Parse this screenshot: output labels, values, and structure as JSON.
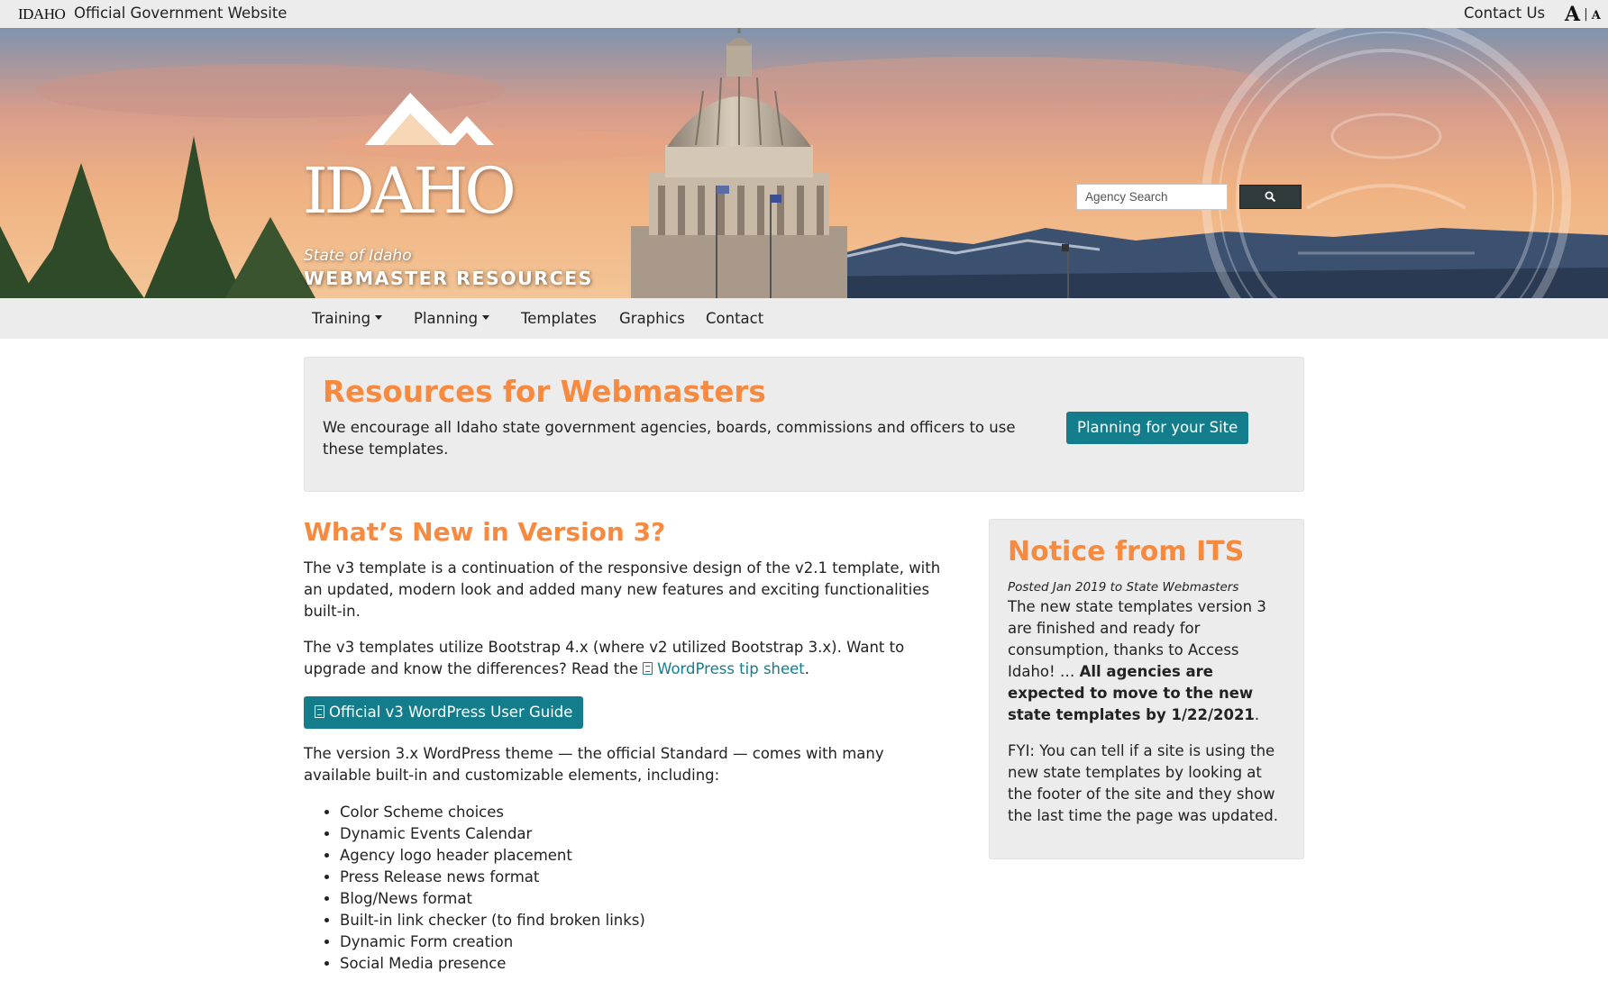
{
  "topbar": {
    "mini_logo": "IDAHO",
    "gov_label": "Official Government Website",
    "contact": "Contact Us",
    "text_large": "A",
    "text_sep": "|",
    "text_small": "A"
  },
  "hero": {
    "logo_word": "IDAHO",
    "state_of": "State of Idaho",
    "site_name": "WEBMASTER RESOURCES",
    "search_placeholder": "Agency Search"
  },
  "nav": {
    "items": [
      {
        "label": "Training",
        "dropdown": true
      },
      {
        "label": "Planning",
        "dropdown": true
      },
      {
        "label": "Templates",
        "dropdown": false
      },
      {
        "label": "Graphics",
        "dropdown": false
      },
      {
        "label": "Contact",
        "dropdown": false
      }
    ]
  },
  "intro": {
    "title": "Resources for Webmasters",
    "text": "We encourage all Idaho state government agencies, boards, commissions and officers to use these templates.",
    "button": "Planning for your Site"
  },
  "main": {
    "heading": "What’s New in Version 3?",
    "p1": "The v3 template is a continuation of the responsive design of the v2.1 template, with an updated, modern look and added many new features and exciting functionalities built-in.",
    "p2_before": "The v3 templates utilize Bootstrap 4.x (where v2 utilized Bootstrap 3.x). Want to upgrade and know the differences? Read the ",
    "p2_link": "WordPress tip sheet",
    "p2_after": ".",
    "guide_button": "Official v3 WordPress User Guide",
    "p3": "The version 3.x WordPress theme — the official Standard — comes with many available built-in and customizable elements, including:",
    "features": [
      "Color Scheme choices",
      "Dynamic Events Calendar",
      "Agency logo header placement",
      "Press Release news format",
      "Blog/News format",
      "Built-in link checker (to find broken links)",
      "Dynamic Form creation",
      "Social Media presence"
    ]
  },
  "notice": {
    "title": "Notice from ITS",
    "posted": "Posted Jan 2019 to State Webmasters",
    "p1_text": "The new state templates version 3 are finished and ready for consumption, thanks to Access Idaho! … ",
    "p1_bold": "All agencies are expected to move to the new state templates by 1/22/2021",
    "p1_end": ".",
    "p2": "FYI: You can tell if a site is using the new state templates by looking at the footer of the site and they show the last time the page was updated."
  },
  "colors": {
    "accent_orange": "#f78a3f",
    "teal_button": "#137d8c",
    "bar_gray": "#ececec",
    "search_button": "#2f3a3d"
  },
  "icons": {
    "search_button": "search-icon",
    "doc": "file-pdf-icon",
    "caret": "caret-down-icon"
  }
}
